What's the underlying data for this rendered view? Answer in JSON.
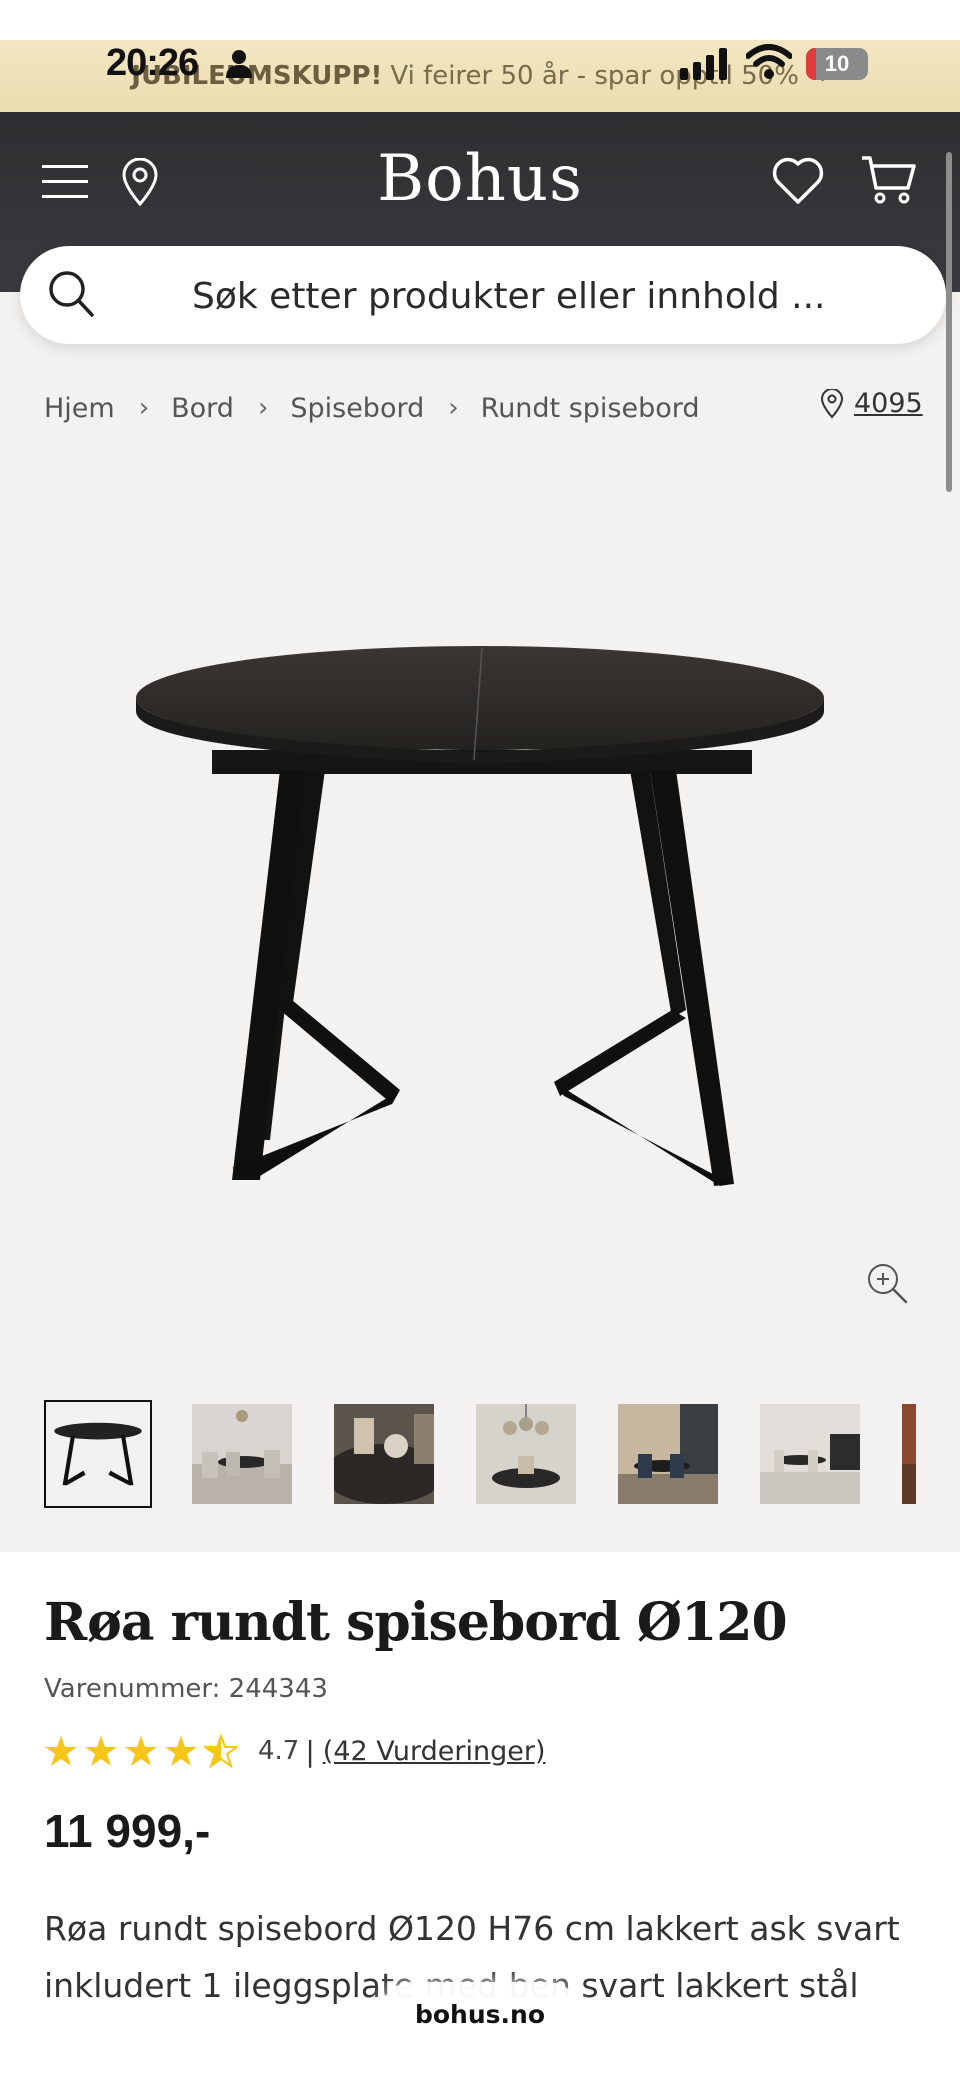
{
  "status_bar": {
    "time": "20:26",
    "battery": "10"
  },
  "promo": {
    "bold": "JUBILEUMSKUPP!",
    "text": "Vi feirer 50 år - spar opptil 50%",
    "arrow": "→"
  },
  "header": {
    "logo": "Bohus",
    "icons": [
      "menu-icon",
      "location-icon",
      "heart-icon",
      "cart-icon"
    ]
  },
  "search": {
    "placeholder": "Søk etter produkter eller innhold ..."
  },
  "breadcrumb": {
    "items": [
      "Hjem",
      "Bord",
      "Spisebord",
      "Rundt spisebord"
    ],
    "separator": "›",
    "store_code": "4095"
  },
  "product": {
    "title": "Røa rundt spisebord Ø120",
    "sku": "Varenummer: 244343",
    "rating_value": "4.7",
    "rating_stars": 4.7,
    "rating_separator": "|",
    "reviews": "(42 Vurderinger)",
    "price": "11 999,-",
    "description": "Røa rundt spisebord Ø120 H76 cm lakkert ask svart inkludert 1 ileggsplate med ben svart lakkert stål"
  },
  "thumbnails": {
    "count_visible": 7,
    "selected_index": 0
  },
  "browser": {
    "url": "bohus.no"
  },
  "colors": {
    "header_bg": "#333336",
    "promo_bg": "#efe1b8",
    "star": "#f5c518",
    "page_bg": "#f4f2f0"
  }
}
